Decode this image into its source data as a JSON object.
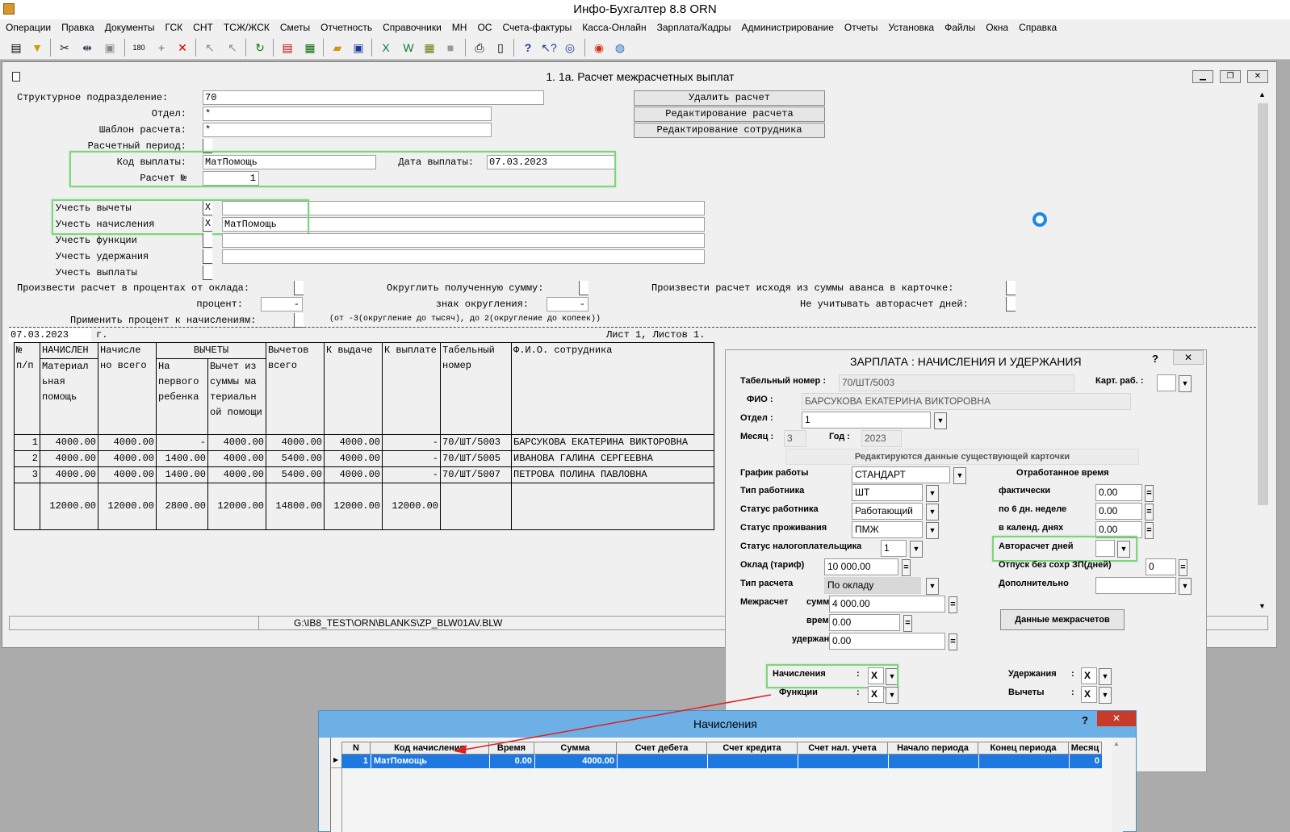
{
  "app": {
    "title": "Инфо-Бухгалтер 8.8   ORN"
  },
  "menu": [
    "Операции",
    "Правка",
    "Документы",
    "ГСК",
    "СНТ",
    "ТСЖ/ЖСК",
    "Сметы",
    "Отчетность",
    "Справочники",
    "МН",
    "ОС",
    "Счета-фактуры",
    "Касса-Онлайн",
    "Зарплата/Кадры",
    "Администрирование",
    "Отчеты",
    "Установка",
    "Файлы",
    "Окна",
    "Справка"
  ],
  "toolbar_icons": [
    "form-icon",
    "filter-icon",
    "cut-icon",
    "split-icon",
    "paste-icon",
    "stamp-icon",
    "add-icon",
    "delete-icon",
    "pointer-icon",
    "multi-pointer-icon",
    "refresh-icon",
    "pdf-icon",
    "calculator-icon",
    "open-folder-icon",
    "save-icon",
    "excel-icon",
    "word-icon",
    "chart-icon",
    "gray-icon",
    "print-icon",
    "preview-icon",
    "help-icon",
    "context-help-icon",
    "compass-icon",
    "lifebuoy-icon",
    "globe-icon"
  ],
  "main": {
    "title": "1. 1а. Расчет межрасчетных выплат",
    "fields": {
      "struct_label": "Структурное подразделение:",
      "struct_value": "70",
      "dept_label": "Отдел:",
      "dept_value": "*",
      "template_label": "Шаблон расчета:",
      "template_value": "*",
      "period_label": "Расчетный период:",
      "code_label": "Код выплаты:",
      "code_value": "МатПомощь",
      "date_label": "Дата выплаты:",
      "date_value": "07.03.2023",
      "calc_label": "Расчет №",
      "calc_value": "1",
      "ded_label": "Учесть вычеты",
      "ded_check": "X",
      "ded_value": "",
      "acc_label": "Учесть начисления",
      "acc_check": "X",
      "acc_value": "МатПомощь",
      "fun_label": "Учесть функции",
      "ret_label": "Учесть удержания",
      "pay_label": "Учесть выплаты",
      "pct_label": "Произвести расчет в процентах от оклада:",
      "pct2_label": "процент:",
      "pct2_value": "-",
      "apply_label": "Применить процент к начислениям:",
      "round_label": "Округлить полученную сумму:",
      "sign_label": "знак округления:",
      "sign_value": "-",
      "round_note": "(от -3(округление до тысяч), до 2(округление до копеек))",
      "adv_label": "Произвести расчет исходя из суммы аванса в карточке:",
      "auto_label": "Не учитывать авторасчет дней:"
    },
    "buttons": {
      "delete": "Удалить расчет",
      "edit_calc": "Редактирование расчета",
      "edit_emp": "Редактирование сотрудника"
    },
    "report": {
      "date": "07.03.2023",
      "year_suffix": "г.",
      "sheet": "Лист 1, Листов 1."
    },
    "status_path": "G:\\IB8_TEST\\ORN\\BLANKS\\ZP_BLW01AV.BLW"
  },
  "table": {
    "headers": {
      "num": "№ п/п",
      "nach": "НАЧИСЛЕН",
      "mat": "Материал ьная помощь",
      "total_acc": "Начисле но всего",
      "ded_group": "ВЫЧЕТЫ",
      "child": "На первого ребенка",
      "matded": "Вычет из суммы ма териальн ой помощи",
      "ded_total": "Вычетов всего",
      "issue": "К выдаче",
      "pay": "К выплате",
      "tab": "Табельный номер",
      "fio": "Ф.И.О. сотрудника"
    },
    "rows": [
      [
        "1",
        "4000.00",
        "4000.00",
        "-",
        "4000.00",
        "4000.00",
        "4000.00",
        "-",
        "70/ШТ/5003",
        "БАРСУКОВА ЕКАТЕРИНА ВИКТОРОВНА"
      ],
      [
        "2",
        "4000.00",
        "4000.00",
        "1400.00",
        "4000.00",
        "5400.00",
        "4000.00",
        "-",
        "70/ШТ/5005",
        "ИВАНОВА ГАЛИНА СЕРГЕЕВНА"
      ],
      [
        "3",
        "4000.00",
        "4000.00",
        "1400.00",
        "4000.00",
        "5400.00",
        "4000.00",
        "-",
        "70/ШТ/5007",
        "ПЕТРОВА ПОЛИНА ПАВЛОВНА"
      ]
    ],
    "totals": [
      "",
      "12000.00",
      "12000.00",
      "2800.00",
      "12000.00",
      "14800.00",
      "12000.00",
      "12000.00",
      "",
      ""
    ]
  },
  "salary_dialog": {
    "title": "ЗАРПЛАТА : НАЧИСЛЕНИЯ И УДЕРЖАНИЯ",
    "help": "?",
    "close": "✕",
    "tab_label": "Табельный номер :",
    "tab_value": "70/ШТ/5003",
    "card_label": "Карт. раб. :",
    "fio_label": "ФИО :",
    "fio_value": "БАРСУКОВА ЕКАТЕРИНА ВИКТОРОВНА",
    "dept_label": "Отдел :",
    "dept_value": "1",
    "month_label": "Месяц :",
    "month_value": "3",
    "year_label": "Год :",
    "year_value": "2023",
    "notice": "Редактируются данные существующей карточки",
    "schedule_label": "График работы",
    "schedule_value": "СТАНДАРТ",
    "worked_title": "Отработанное время",
    "type_label": "Тип работника",
    "type_value": "ШТ",
    "status_label": "Статус работника",
    "status_value": "Работающий",
    "res_label": "Статус проживания",
    "res_value": "ПМЖ",
    "tax_label": "Статус налогоплательщика",
    "tax_value": "1",
    "salary_label": "Оклад (тариф)",
    "salary_value": "10 000.00",
    "calc_type_label": "Тип расчета",
    "calc_type_value": "По окладу",
    "inter_label": "Межрасчет",
    "sum_label": "сумма",
    "sum_value": "4 000.00",
    "time_label": "время",
    "time_value": "0.00",
    "held_label": "удержано",
    "held_value": "0.00",
    "fact_label": "фактически",
    "fact_value": "0.00",
    "six_label": "по 6 дн. неделе",
    "six_value": "0.00",
    "cal_label": "в календ. днях",
    "cal_value": "0.00",
    "autodays_label": "Авторасчет дней",
    "leave_label": "Отпуск без сохр ЗП(дней)",
    "leave_value": "0",
    "extra_label": "Дополнительно",
    "inter_btn": "Данные межрасчетов",
    "acc_label": "Начисления",
    "acc_value": "X",
    "fun_label": "Функции",
    "fun_value": "X",
    "ret_label": "Удержания",
    "ret_value": "X",
    "ded_label": "Вычеты",
    "ded_value": "X"
  },
  "accrual_dialog": {
    "title": "Начисления",
    "help": "?",
    "close": "✕",
    "columns": [
      "N",
      "Код начисления",
      "Время",
      "Сумма",
      "Счет дебета",
      "Счет кредита",
      "Счет нал. учета",
      "Начало периода",
      "Конец периода",
      "Месяц"
    ],
    "row": [
      "1",
      "МатПомощь",
      "0.00",
      "4000.00",
      "",
      "",
      "",
      "",
      "",
      "0"
    ]
  },
  "colors": {
    "highlight": "#7dd67d",
    "annotation_arrow": "#e02020",
    "selection": "#1e78e0",
    "dialog_header": "#6db0e6"
  }
}
